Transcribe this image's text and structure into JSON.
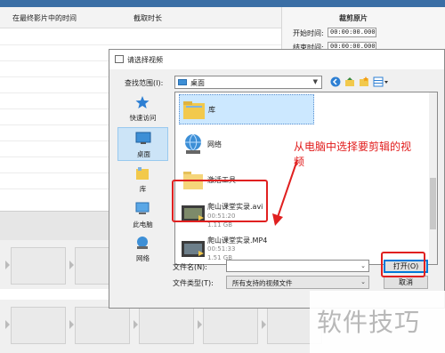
{
  "background_app": {
    "column_headers": [
      "在最终影片中的时间",
      "截取时长"
    ],
    "clip_panel": {
      "title": "裁剪原片",
      "start_label": "开始时间:",
      "start_value": "00:00:00.000",
      "end_label": "结束时间:",
      "end_value": "00:00:00.000"
    }
  },
  "dialog": {
    "title": "请选择视频",
    "look_in_label": "查找范围(I):",
    "look_in_value": "桌面",
    "places": [
      {
        "label": "快速访问",
        "icon": "star-icon"
      },
      {
        "label": "桌面",
        "icon": "desktop-icon",
        "selected": true
      },
      {
        "label": "库",
        "icon": "library-icon"
      },
      {
        "label": "此电脑",
        "icon": "computer-icon"
      },
      {
        "label": "网络",
        "icon": "network-icon"
      }
    ],
    "files": [
      {
        "name": "库",
        "icon": "library-folder-icon",
        "selected": true
      },
      {
        "name": "网络",
        "icon": "network-globe-icon"
      },
      {
        "name": "激活工具",
        "icon": "folder-icon"
      },
      {
        "name": "爬山课堂实录.avi",
        "duration": "00:51:20",
        "size": "1.11 GB",
        "icon": "video-file-icon"
      },
      {
        "name": "爬山课堂实录.MP4",
        "duration": "00:51:33",
        "size": "1.51 GB",
        "icon": "video-file-icon"
      }
    ],
    "file_name_label": "文件名(N):",
    "file_name_value": "",
    "file_type_label": "文件类型(T):",
    "file_type_value": "所有支持的视频文件",
    "open_button": "打开(O)",
    "cancel_button": "取消"
  },
  "annotation": {
    "text": "从电脑中选择要剪辑的视频",
    "color": "#e11b1b"
  },
  "watermark": "软件技巧"
}
